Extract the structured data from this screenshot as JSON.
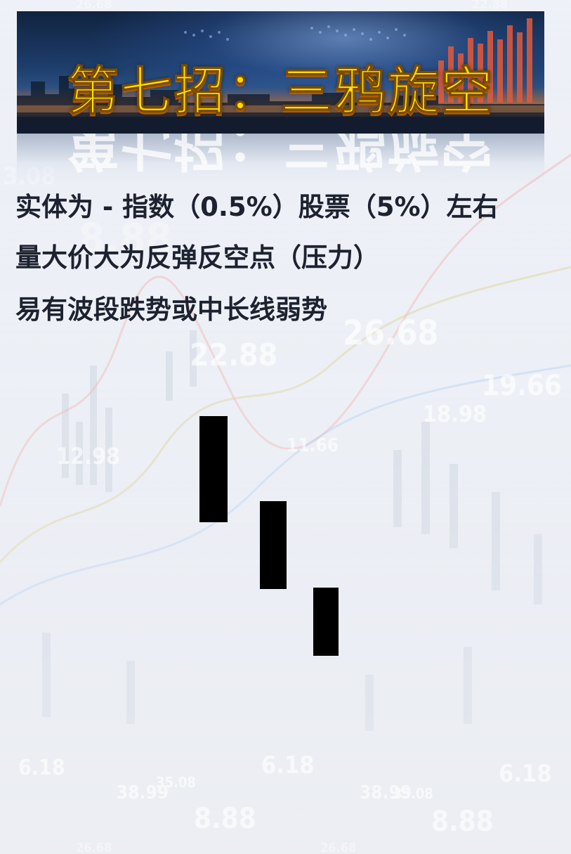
{
  "banner": {
    "title": "第七招：三鸦旋空",
    "title_color": "#ffe000"
  },
  "content": {
    "lines": [
      "实体为 - 指数（0.5%）股票（5%）左右",
      "量大价大为反弹反空点（压力）",
      "易有波段跌势或中长线弱势"
    ],
    "text_color": "#1d2230"
  },
  "pattern": {
    "name": "three black crows",
    "candle_color": "#000000",
    "candle_count": 3
  },
  "background_numbers": [
    "26.68",
    "22.88",
    "3.08",
    "8.88",
    "22.88",
    "26.68",
    "19.66",
    "18.98",
    "12.98",
    "11.66",
    "6.18",
    "38.99",
    "35.08",
    "8.88",
    "6.18",
    "38.99",
    "35.08",
    "8.88",
    "6.18",
    "26.68",
    "26.68"
  ]
}
